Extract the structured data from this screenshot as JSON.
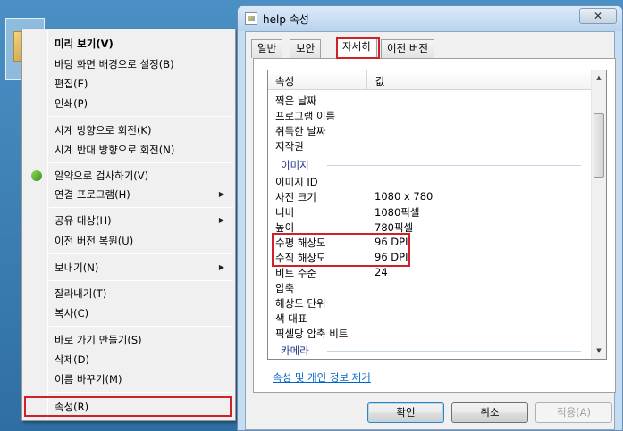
{
  "context_menu": {
    "items": [
      {
        "label": "미리 보기(V)",
        "bold": true
      },
      {
        "label": "바탕 화면 배경으로 설정(B)"
      },
      {
        "label": "편집(E)"
      },
      {
        "label": "인쇄(P)"
      },
      {
        "label": "시계 방향으로 회전(K)"
      },
      {
        "label": "시계 반대 방향으로 회전(N)"
      },
      {
        "label": "알약으로 검사하기(V)"
      },
      {
        "label": "연결 프로그램(H)"
      },
      {
        "label": "공유 대상(H)"
      },
      {
        "label": "이전 버전 복원(U)"
      },
      {
        "label": "보내기(N)"
      },
      {
        "label": "잘라내기(T)"
      },
      {
        "label": "복사(C)"
      },
      {
        "label": "바로 가기 만들기(S)"
      },
      {
        "label": "삭제(D)"
      },
      {
        "label": "이름 바꾸기(M)"
      },
      {
        "label": "속성(R)"
      }
    ]
  },
  "dialog": {
    "title": "help 속성",
    "close_label": "✕",
    "tabs": [
      {
        "label": "일반"
      },
      {
        "label": "보안"
      },
      {
        "label": "자세히"
      },
      {
        "label": "이전 버전"
      }
    ],
    "columns": {
      "name": "속성",
      "value": "값"
    },
    "rows": [
      {
        "name": "찍은 날짜",
        "value": ""
      },
      {
        "name": "프로그램 이름",
        "value": ""
      },
      {
        "name": "취득한 날짜",
        "value": ""
      },
      {
        "name": "저작권",
        "value": ""
      },
      {
        "group": "이미지"
      },
      {
        "name": "이미지 ID",
        "value": ""
      },
      {
        "name": "사진 크기",
        "value": "1080 x 780"
      },
      {
        "name": "너비",
        "value": "1080픽셀"
      },
      {
        "name": "높이",
        "value": "780픽셀"
      },
      {
        "name": "수평 해상도",
        "value": "96 DPI"
      },
      {
        "name": "수직 해상도",
        "value": "96 DPI"
      },
      {
        "name": "비트 수준",
        "value": "24"
      },
      {
        "name": "압축",
        "value": ""
      },
      {
        "name": "해상도 단위",
        "value": ""
      },
      {
        "name": "색 대표",
        "value": ""
      },
      {
        "name": "픽셀당 압축 비트",
        "value": ""
      },
      {
        "group": "카메라"
      }
    ],
    "remove_link": "속성 및 개인 정보 제거",
    "buttons": {
      "ok": "확인",
      "cancel": "취소",
      "apply": "적용(A)"
    }
  },
  "colors": {
    "highlight": "#d0202a",
    "link": "#0066cc",
    "group": "#1e3287"
  }
}
